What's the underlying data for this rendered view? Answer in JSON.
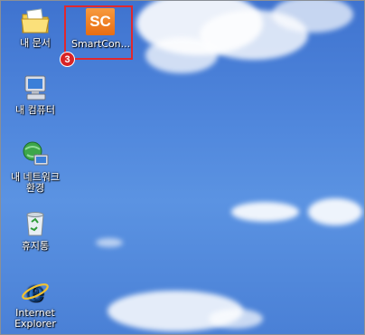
{
  "desktop": {
    "icons": [
      {
        "label": "내 문서",
        "icon": "my-documents-icon"
      },
      {
        "label": "SmartCon...",
        "icon": "smartcon-app-icon",
        "logo_text": "SC"
      },
      {
        "label": "내 컴퓨터",
        "icon": "my-computer-icon"
      },
      {
        "label": "내 네트워크 환경",
        "icon": "network-places-icon"
      },
      {
        "label": "휴지통",
        "icon": "recycle-bin-icon"
      },
      {
        "label": "Internet Explorer",
        "icon": "internet-explorer-icon"
      }
    ],
    "callout_number": "3"
  },
  "colors": {
    "sky_top": "#3f73cf",
    "sky_bottom": "#4a80d6",
    "highlight": "#e0282e",
    "smartcon_orange": "#f08a2a"
  }
}
